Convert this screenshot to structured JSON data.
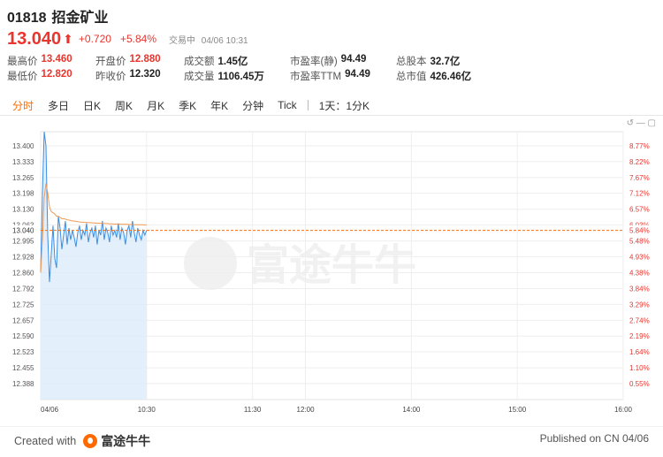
{
  "header": {
    "code": "01818",
    "name": "招金矿业",
    "price": "13.040",
    "change": "+0.720",
    "change_pct": "+5.84%",
    "status": "交易中",
    "datetime": "04/06 10:31"
  },
  "stats": [
    [
      {
        "label": "最高价",
        "value": "13.460",
        "red": true
      },
      {
        "label": "开盘价",
        "value": "12.880",
        "red": true
      },
      {
        "label": "成交额",
        "value": "1.45亿",
        "red": false
      },
      {
        "label": "市盈率(静)",
        "value": "94.49",
        "red": false
      },
      {
        "label": "总股本",
        "value": "32.7亿",
        "red": false
      }
    ],
    [
      {
        "label": "最低价",
        "value": "12.820",
        "red": true
      },
      {
        "label": "昨收价",
        "value": "12.320",
        "red": false
      },
      {
        "label": "成交量",
        "value": "1106.45万",
        "red": false
      },
      {
        "label": "市盈率TTM",
        "value": "94.49",
        "red": false
      },
      {
        "label": "总市值",
        "value": "426.46亿",
        "red": false
      }
    ]
  ],
  "tabs": [
    "分时",
    "多日",
    "日K",
    "周K",
    "月K",
    "季K",
    "年K",
    "分钟",
    "Tick"
  ],
  "period_label": "1天：1分K",
  "colors": {
    "up": "#e8352e",
    "price_line": "#3a8ee6",
    "avg_line": "#f09a56",
    "ref_line": "#ff6a00",
    "grid": "#eeeeee",
    "area_top": "#dbe9fb"
  },
  "chart_data": {
    "type": "line",
    "prev_close": 12.32,
    "current": 13.04,
    "ylim": [
      12.32,
      13.46
    ],
    "y_ticks_left": [
      "13.400",
      "13.333",
      "13.265",
      "13.198",
      "13.130",
      "13.063",
      "12.995",
      "12.928",
      "12.860",
      "12.792",
      "12.725",
      "12.657",
      "12.590",
      "12.523",
      "12.455",
      "12.388"
    ],
    "y_ticks_right": [
      "8.77%",
      "8.22%",
      "7.67%",
      "7.12%",
      "6.57%",
      "6.03%",
      "5.48%",
      "4.93%",
      "4.38%",
      "3.84%",
      "3.29%",
      "2.74%",
      "2.19%",
      "1.64%",
      "1.10%",
      "0.55%"
    ],
    "current_tag_left": "13.040",
    "current_tag_right": "5.84%",
    "x_ticks": [
      {
        "min": 0,
        "label": "04/06"
      },
      {
        "min": 60,
        "label": "10:30"
      },
      {
        "min": 120,
        "label": "11:30"
      },
      {
        "min": 150,
        "label": "12:00"
      },
      {
        "min": 210,
        "label": "14:00"
      },
      {
        "min": 270,
        "label": "15:00"
      },
      {
        "min": 330,
        "label": "16:00"
      }
    ],
    "x_range_min": [
      0,
      330
    ],
    "series": [
      {
        "values": [
          12.86,
          13.2,
          13.46,
          13.4,
          13.02,
          12.82,
          12.94,
          13.06,
          12.92,
          12.88,
          13.1,
          13.05,
          12.96,
          13.02,
          13.08,
          12.98,
          13.05,
          13.0,
          13.04,
          13.01,
          12.97,
          13.03,
          13.06,
          13.0,
          13.04,
          13.02,
          13.07,
          12.99,
          13.03,
          13.05,
          13.01,
          13.06,
          12.98,
          13.04,
          13.02,
          13.08,
          13.0,
          13.05,
          13.03,
          12.99,
          13.06,
          13.02,
          13.04,
          13.01,
          13.07,
          13.0,
          13.05,
          13.03,
          12.98,
          13.04,
          13.06,
          13.01,
          13.08,
          13.03,
          12.99,
          13.05,
          13.02,
          13.0,
          13.04,
          13.02,
          13.04
        ]
      },
      {
        "values": [
          12.86,
          13.0,
          13.18,
          13.24,
          13.2,
          13.14,
          13.12,
          13.115,
          13.11,
          13.1,
          13.1,
          13.095,
          13.09,
          13.09,
          13.088,
          13.085,
          13.084,
          13.082,
          13.08,
          13.08,
          13.078,
          13.077,
          13.076,
          13.075,
          13.075,
          13.074,
          13.074,
          13.073,
          13.073,
          13.072,
          13.072,
          13.071,
          13.071,
          13.07,
          13.07,
          13.07,
          13.069,
          13.069,
          13.069,
          13.068,
          13.068,
          13.068,
          13.067,
          13.067,
          13.067,
          13.067,
          13.066,
          13.066,
          13.066,
          13.066,
          13.065,
          13.065,
          13.065,
          13.065,
          13.064,
          13.064,
          13.064,
          13.064,
          13.064,
          13.063,
          13.063
        ]
      }
    ]
  }
}
